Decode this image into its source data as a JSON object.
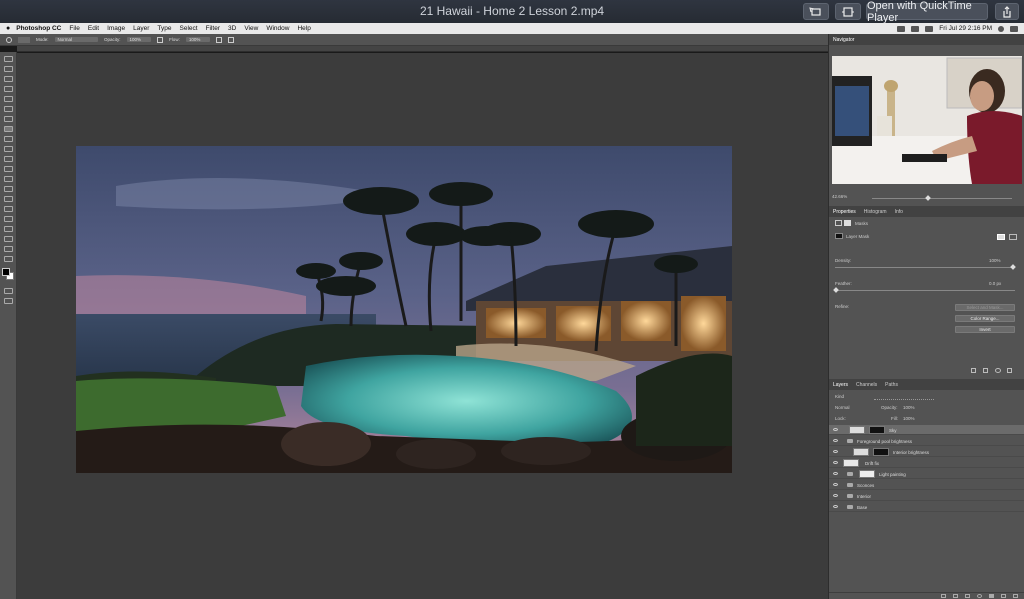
{
  "quicktime": {
    "title": "21 Hawaii - Home 2 Lesson 2.mp4",
    "open_with_label": "Open with QuickTime Player",
    "share_icon": "share-icon",
    "rotate_icon": "rotate-icon",
    "trim_icon": "trim-icon"
  },
  "menubar": {
    "app_name": "Photoshop CC",
    "items": [
      "File",
      "Edit",
      "Image",
      "Layer",
      "Type",
      "Select",
      "Filter",
      "3D",
      "View",
      "Window",
      "Help"
    ],
    "clock": "Fri Jul 29  2:16 PM"
  },
  "options": {
    "mode_label": "Mode:",
    "mode_value": "Normal",
    "opacity_label": "Opacity:",
    "opacity_value": "100%",
    "flow_label": "Flow:",
    "flow_value": "100%"
  },
  "navigator": {
    "tab": "Navigator",
    "zoom": "42.66%"
  },
  "properties": {
    "tabs": [
      "Properties",
      "Histogram",
      "Info"
    ],
    "kind": "Masks",
    "mask_type": "Layer Mask",
    "density_label": "Density:",
    "density_value": "100%",
    "feather_label": "Feather:",
    "feather_value": "0.0 px",
    "refine_label": "Refine:",
    "select_mask_label": "Select and Mask...",
    "color_range_label": "Color Range...",
    "invert_label": "Invert"
  },
  "layers": {
    "tabs": [
      "Layers",
      "Channels",
      "Paths"
    ],
    "filter_kind": "Kind",
    "blend_mode": "Normal",
    "opacity_label": "Opacity:",
    "opacity_value": "100%",
    "lock_label": "Lock:",
    "fill_label": "Fill:",
    "fill_value": "100%",
    "items": [
      {
        "name": "Sky",
        "selected": true,
        "thumb": "mask-dark"
      },
      {
        "name": "Foreground pool brightness",
        "folder": true
      },
      {
        "name": "Interior brightness",
        "thumb": "mask-dark"
      },
      {
        "name": "Drift fix",
        "thumb": "white"
      },
      {
        "name": "Light painting",
        "thumb": "mask-light"
      },
      {
        "name": "Sconces",
        "folder": true
      },
      {
        "name": "Interior",
        "folder": true
      },
      {
        "name": "Base",
        "folder": true
      }
    ]
  },
  "colors": {
    "ps_panel": "#535353",
    "ps_canvas_bg": "#3c3c3c",
    "qt_bar": "#2b3039"
  }
}
